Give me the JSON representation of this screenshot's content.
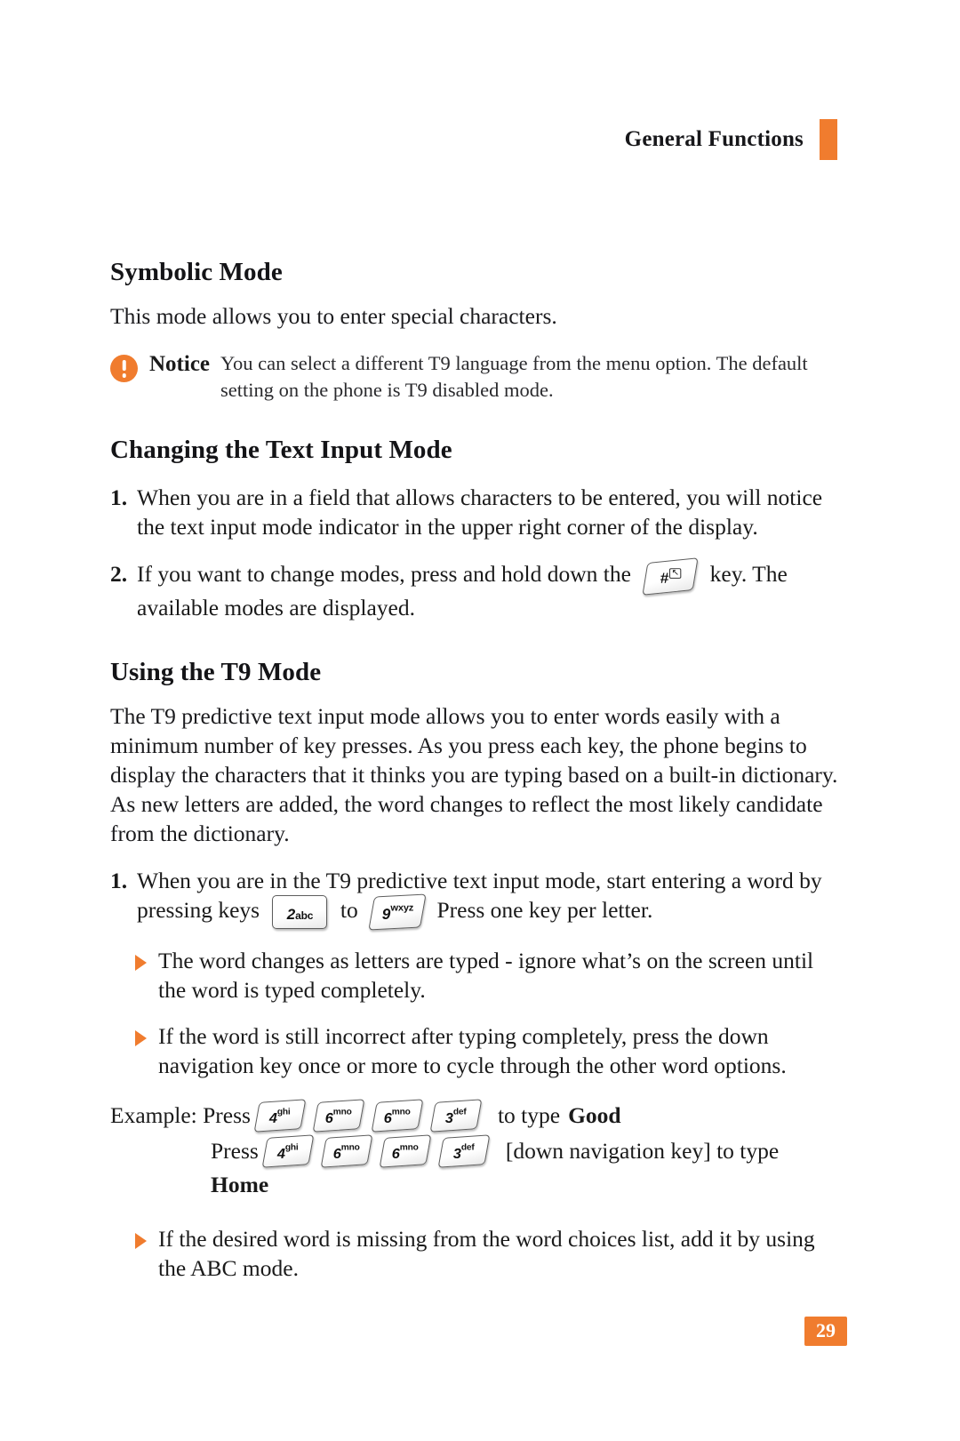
{
  "document": {
    "header_title": "General Functions",
    "page_number": "29",
    "accent_color": "#F07C2E",
    "text_color": "#1a1a1a",
    "background_color": "#ffffff"
  },
  "sections": {
    "symbolic_mode": {
      "heading": "Symbolic Mode",
      "body": "This mode allows you to enter special characters.",
      "notice": {
        "icon": "exclamation-circle-icon",
        "label": "Notice",
        "text": "You can select a different T9 language from the menu option. The default setting on the phone is T9 disabled mode."
      }
    },
    "changing_text_input_mode": {
      "heading": "Changing the Text Input Mode",
      "items": [
        {
          "marker": "1.",
          "text": "When you are in a field that allows characters to be entered, you will notice the text input mode indicator in the upper right corner of the display."
        },
        {
          "marker": "2.",
          "text_before": "If you want to change modes, press and hold down the",
          "key": {
            "symbol": "#",
            "superscript": "↖",
            "name": "hash-key"
          },
          "text_after": "key. The available modes are displayed."
        }
      ]
    },
    "using_t9_mode": {
      "heading": "Using the T9 Mode",
      "body": "The T9 predictive text input mode allows you to enter words easily with a minimum number of key presses. As you press each key, the phone begins to display the characters that it thinks you are typing based on a built-in dictionary. As new letters are added, the word changes to reflect the most likely candidate from the dictionary.",
      "numbered": {
        "marker": "1.",
        "text_before": "When you are in the T9 predictive text input mode, start entering a word by pressing keys",
        "key_first": {
          "num": "2",
          "letters": "abc",
          "name": "key-2-abc"
        },
        "text_mid": "to",
        "key_last": {
          "num": "9",
          "letters": "wxyz",
          "name": "key-9-wxyz"
        },
        "text_after": "Press one key per letter."
      },
      "bullets": [
        "The word changes as letters are typed - ignore what’s on the screen until the word is typed completely.",
        "If the word is still incorrect after typing completely, press the down navigation key once or more to cycle through the other word options."
      ],
      "example": {
        "row1_label": "Example: Press",
        "row1_keys": [
          {
            "num": "4",
            "letters": "ghi",
            "name": "key-4-ghi"
          },
          {
            "num": "6",
            "letters": "mno",
            "name": "key-6-mno"
          },
          {
            "num": "6",
            "letters": "mno",
            "name": "key-6-mno"
          },
          {
            "num": "3",
            "letters": "def",
            "name": "key-3-def"
          }
        ],
        "row1_tail": "to type",
        "row1_word": "Good",
        "row2_label": "Press",
        "row2_keys": [
          {
            "num": "4",
            "letters": "ghi",
            "name": "key-4-ghi"
          },
          {
            "num": "6",
            "letters": "mno",
            "name": "key-6-mno"
          },
          {
            "num": "6",
            "letters": "mno",
            "name": "key-6-mno"
          },
          {
            "num": "3",
            "letters": "def",
            "name": "key-3-def"
          }
        ],
        "row2_tail": "[down navigation key] to type",
        "row2_word": "Home"
      },
      "final_bullet": "If the desired word is missing from the word choices list, add it by using the ABC mode."
    }
  }
}
